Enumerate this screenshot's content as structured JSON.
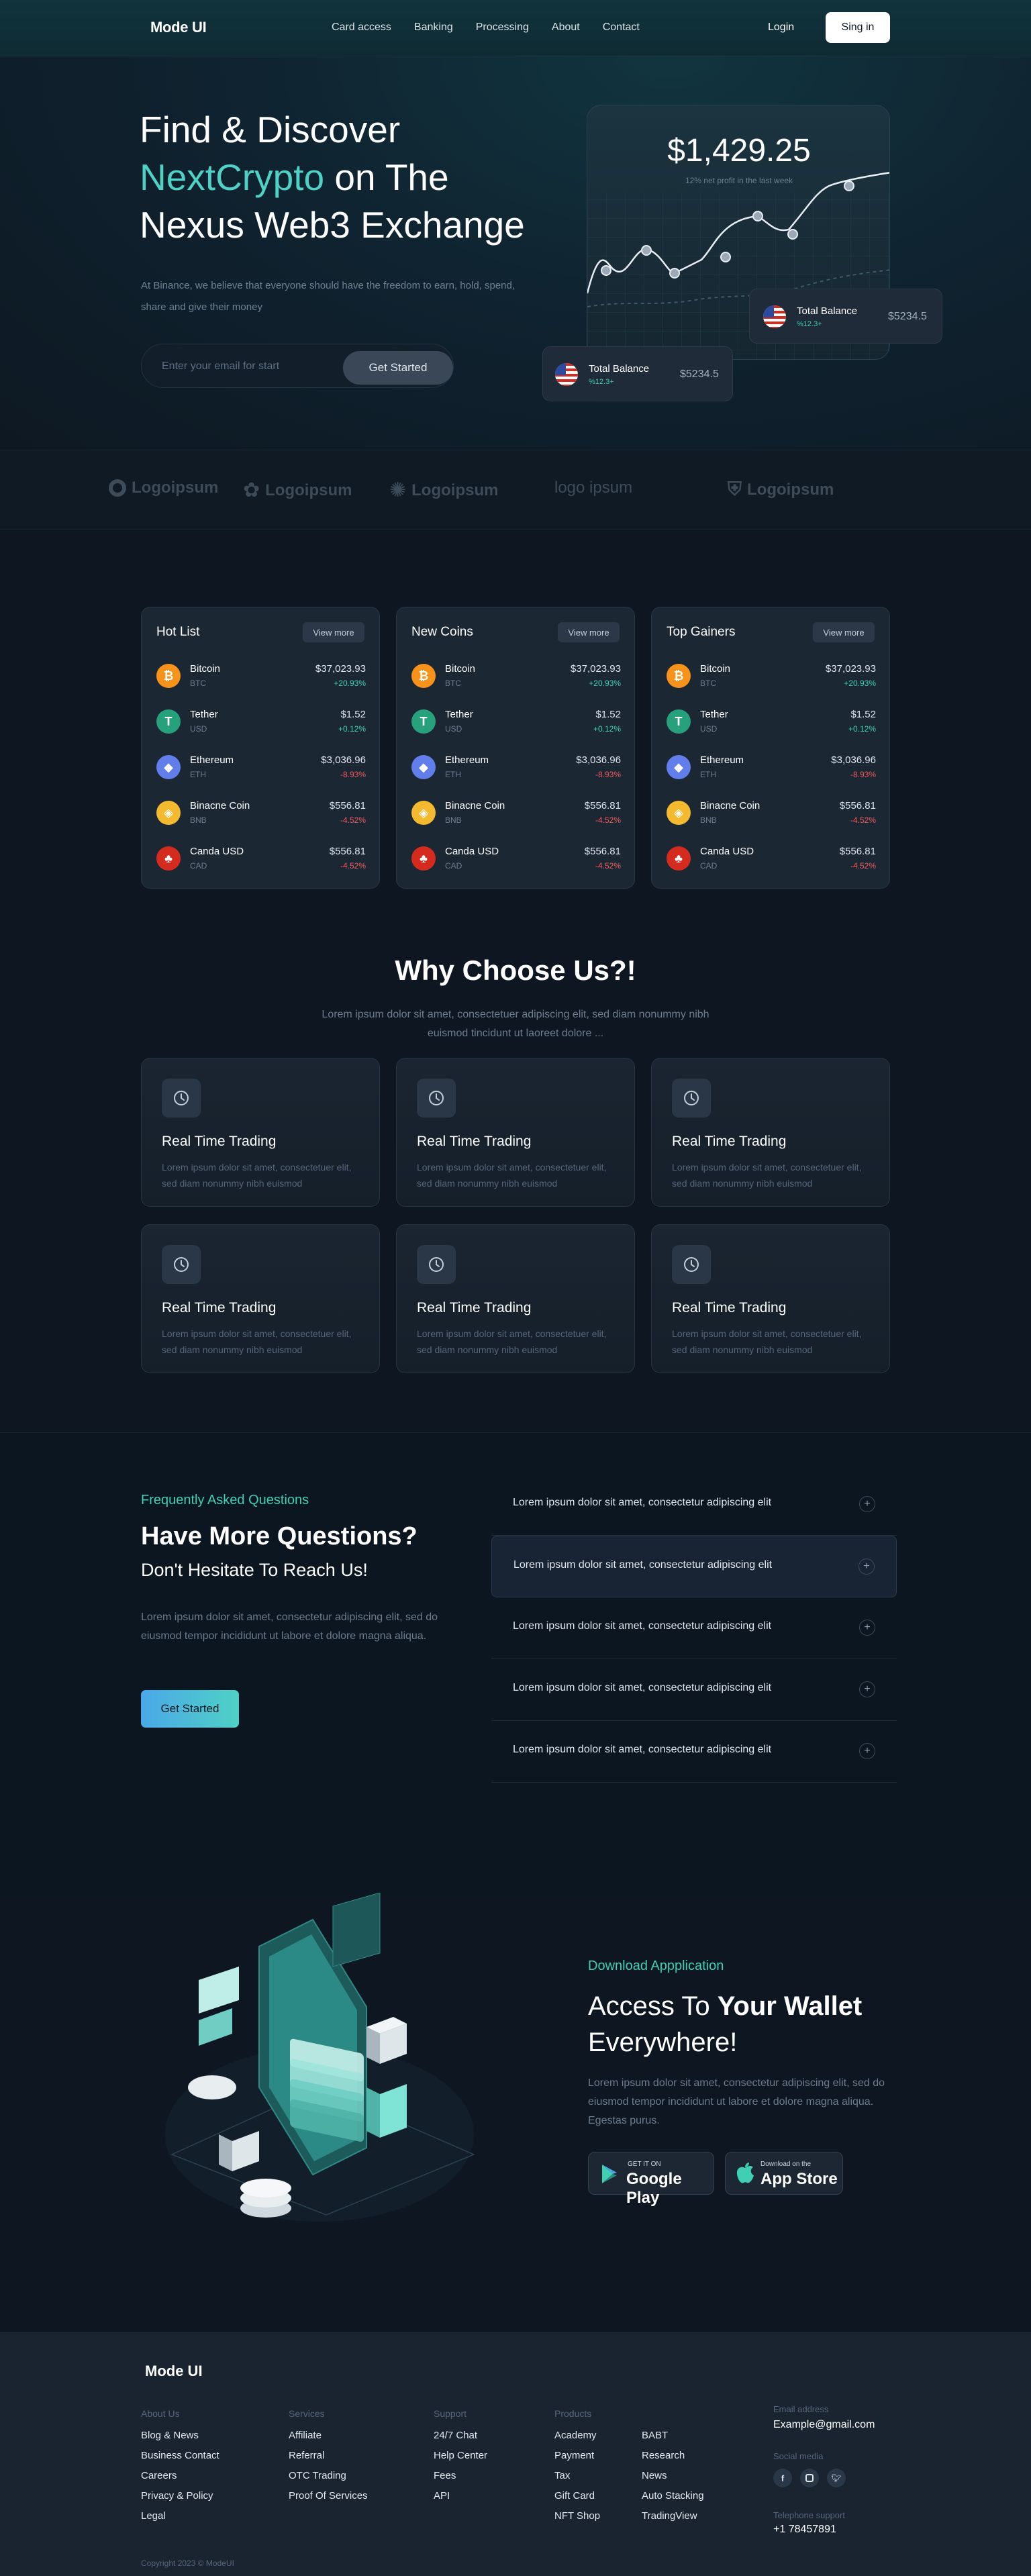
{
  "nav": {
    "logo": "Mode UI",
    "links": [
      "Card access",
      "Banking",
      "Processing",
      "About",
      "Contact"
    ],
    "login": "Login",
    "signin": "Sing in"
  },
  "hero": {
    "title_line1": "Find & Discover",
    "title_accent": "NextCrypto",
    "title_line2_rest": " on The",
    "title_line3": "Nexus Web3 Exchange",
    "description": "At Binance, we believe that everyone should have the freedom to earn, hold, spend, share and give their money",
    "email_placeholder": "Enter your email for start",
    "cta": "Get Started",
    "chart": {
      "amount": "$1,429.25",
      "subtitle": "12% net profit in the last week"
    },
    "balance_cards": [
      {
        "title": "Total Balance",
        "sub": "%12.3+",
        "value": "$5234.5"
      },
      {
        "title": "Total Balance",
        "sub": "%12.3+",
        "value": "$5234.5"
      }
    ]
  },
  "partners": [
    "Logoipsum",
    "Logoipsum",
    "Logoipsum",
    "logo ipsum",
    "Logoipsum"
  ],
  "markets": [
    {
      "title": "Hot List",
      "more": "View more",
      "coins": [
        {
          "name": "Bitcoin",
          "sym": "BTC",
          "price": "$37,023.93",
          "change": "+20.93%",
          "dir": "up",
          "icon": "bitcoin-icon",
          "color": "#f7931a",
          "glyph": "₿"
        },
        {
          "name": "Tether",
          "sym": "USD",
          "price": "$1.52",
          "change": "+0.12%",
          "dir": "up",
          "icon": "tether-icon",
          "color": "#26a17b",
          "glyph": "T"
        },
        {
          "name": "Ethereum",
          "sym": "ETH",
          "price": "$3,036.96",
          "change": "-8.93%",
          "dir": "down",
          "icon": "ethereum-icon",
          "color": "#627eea",
          "glyph": "◆"
        },
        {
          "name": "Binacne Coin",
          "sym": "BNB",
          "price": "$556.81",
          "change": "-4.52%",
          "dir": "down",
          "icon": "binance-icon",
          "color": "#f3ba2f",
          "glyph": "◈"
        },
        {
          "name": "Canda USD",
          "sym": "CAD",
          "price": "$556.81",
          "change": "-4.52%",
          "dir": "down",
          "icon": "canada-icon",
          "color": "#d52b1e",
          "glyph": "♣"
        }
      ]
    },
    {
      "title": "New Coins",
      "more": "View more",
      "coins": [
        {
          "name": "Bitcoin",
          "sym": "BTC",
          "price": "$37,023.93",
          "change": "+20.93%",
          "dir": "up",
          "icon": "bitcoin-icon",
          "color": "#f7931a",
          "glyph": "₿"
        },
        {
          "name": "Tether",
          "sym": "USD",
          "price": "$1.52",
          "change": "+0.12%",
          "dir": "up",
          "icon": "tether-icon",
          "color": "#26a17b",
          "glyph": "T"
        },
        {
          "name": "Ethereum",
          "sym": "ETH",
          "price": "$3,036.96",
          "change": "-8.93%",
          "dir": "down",
          "icon": "ethereum-icon",
          "color": "#627eea",
          "glyph": "◆"
        },
        {
          "name": "Binacne Coin",
          "sym": "BNB",
          "price": "$556.81",
          "change": "-4.52%",
          "dir": "down",
          "icon": "binance-icon",
          "color": "#f3ba2f",
          "glyph": "◈"
        },
        {
          "name": "Canda USD",
          "sym": "CAD",
          "price": "$556.81",
          "change": "-4.52%",
          "dir": "down",
          "icon": "canada-icon",
          "color": "#d52b1e",
          "glyph": "♣"
        }
      ]
    },
    {
      "title": "Top Gainers",
      "more": "View more",
      "coins": [
        {
          "name": "Bitcoin",
          "sym": "BTC",
          "price": "$37,023.93",
          "change": "+20.93%",
          "dir": "up",
          "icon": "bitcoin-icon",
          "color": "#f7931a",
          "glyph": "₿"
        },
        {
          "name": "Tether",
          "sym": "USD",
          "price": "$1.52",
          "change": "+0.12%",
          "dir": "up",
          "icon": "tether-icon",
          "color": "#26a17b",
          "glyph": "T"
        },
        {
          "name": "Ethereum",
          "sym": "ETH",
          "price": "$3,036.96",
          "change": "-8.93%",
          "dir": "down",
          "icon": "ethereum-icon",
          "color": "#627eea",
          "glyph": "◆"
        },
        {
          "name": "Binacne Coin",
          "sym": "BNB",
          "price": "$556.81",
          "change": "-4.52%",
          "dir": "down",
          "icon": "binance-icon",
          "color": "#f3ba2f",
          "glyph": "◈"
        },
        {
          "name": "Canda USD",
          "sym": "CAD",
          "price": "$556.81",
          "change": "-4.52%",
          "dir": "down",
          "icon": "canada-icon",
          "color": "#d52b1e",
          "glyph": "♣"
        }
      ]
    }
  ],
  "why": {
    "title": "Why Choose Us?!",
    "description": "Lorem ipsum dolor sit amet, consectetuer adipiscing elit, sed diam nonummy nibh euismod tincidunt ut laoreet dolore ...",
    "features": [
      {
        "title": "Real Time Trading",
        "desc": "Lorem ipsum dolor sit amet, consectetuer elit, sed diam nonummy nibh euismod"
      },
      {
        "title": "Real Time Trading",
        "desc": "Lorem ipsum dolor sit amet, consectetuer elit, sed diam nonummy nibh euismod"
      },
      {
        "title": "Real Time Trading",
        "desc": "Lorem ipsum dolor sit amet, consectetuer elit, sed diam nonummy nibh euismod"
      },
      {
        "title": "Real Time Trading",
        "desc": "Lorem ipsum dolor sit amet, consectetuer elit, sed diam nonummy nibh euismod"
      },
      {
        "title": "Real Time Trading",
        "desc": "Lorem ipsum dolor sit amet, consectetuer elit, sed diam nonummy nibh euismod"
      },
      {
        "title": "Real Time Trading",
        "desc": "Lorem ipsum dolor sit amet, consectetuer elit, sed diam nonummy nibh euismod"
      }
    ]
  },
  "faq": {
    "kicker": "Frequently Asked Questions",
    "heading": "Have More Questions?",
    "subheading": "Don't Hesitate To Reach Us!",
    "description": "Lorem ipsum dolor sit amet, consectetur adipiscing elit, sed do eiusmod tempor incididunt ut labore et dolore magna aliqua.",
    "cta": "Get Started",
    "items": [
      "Lorem ipsum dolor sit amet, consectetur adipiscing elit",
      "Lorem ipsum dolor sit amet, consectetur adipiscing elit",
      "Lorem ipsum dolor sit amet, consectetur adipiscing elit",
      "Lorem ipsum dolor sit amet, consectetur adipiscing elit",
      "Lorem ipsum dolor sit amet, consectetur adipiscing elit"
    ],
    "expanded_index": 1
  },
  "app": {
    "kicker": "Download Appplication",
    "heading_plain": "Access To ",
    "heading_bold": "Your Wallet",
    "heading_line2": "Everywhere!",
    "description": "Lorem ipsum dolor sit amet, consectetur adipiscing elit, sed do eiusmod tempor incididunt ut labore et dolore magna aliqua. Egestas purus.",
    "google_small": "GET IT ON",
    "google_big": "Google Play",
    "apple_small": "Download on the",
    "apple_big": "App Store"
  },
  "footer": {
    "logo": "Mode UI",
    "columns": [
      {
        "head": "About Us",
        "links": [
          "Blog & News",
          "Business Contact",
          "Careers",
          "Privacy & Policy",
          "Legal"
        ]
      },
      {
        "head": "Services",
        "links": [
          "Affiliate",
          "Referral",
          "OTC Trading",
          "Proof Of Services"
        ]
      },
      {
        "head": "Support",
        "links": [
          "24/7 Chat",
          "Help Center",
          "Fees",
          "API"
        ]
      },
      {
        "head": "Products",
        "links": [
          "Academy",
          "Payment",
          "Tax",
          "Gift Card",
          "NFT Shop"
        ]
      },
      {
        "head": "",
        "links": [
          "BABT",
          "Research",
          "News",
          "Auto Stacking",
          "TradingView"
        ]
      }
    ],
    "email_label": "Email address",
    "email": "Example@gmail.com",
    "social_label": "Social media",
    "social": [
      "facebook-icon",
      "instagram-icon",
      "twitter-icon"
    ],
    "phone_label": "Telephone support",
    "phone": "+1 78457891",
    "copyright": "Copyright 2023 © ModeUI"
  }
}
